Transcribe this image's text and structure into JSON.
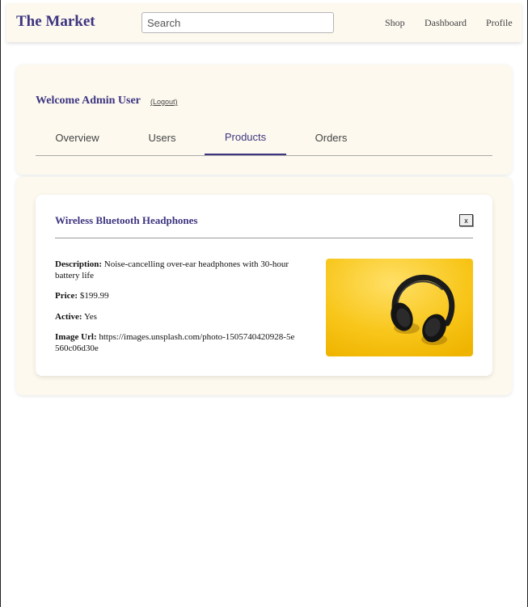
{
  "header": {
    "brand": "The Market",
    "search_placeholder": "Search",
    "nav": [
      "Shop",
      "Dashboard",
      "Profile"
    ]
  },
  "welcome": {
    "text": "Welcome Admin User",
    "logout": "(Logout)"
  },
  "tabs": [
    {
      "label": "Overview",
      "active": false
    },
    {
      "label": "Users",
      "active": false
    },
    {
      "label": "Products",
      "active": true
    },
    {
      "label": "Orders",
      "active": false
    }
  ],
  "product": {
    "title": "Wireless Bluetooth Headphones",
    "close_label": "x",
    "description_label": "Description:",
    "description": "Noise-cancelling over-ear headphones with 30-hour battery life",
    "price_label": "Price:",
    "price": "$199.99",
    "active_label": "Active:",
    "active": "Yes",
    "image_url_label": "Image Url:",
    "image_url": "https://images.unsplash.com/photo-1505740420928-5e560c06d30e",
    "image_icon": "headphones-image"
  },
  "colors": {
    "accent": "#3d3580",
    "card_bg": "#fdf9ef",
    "image_bg": "#f7c318"
  }
}
